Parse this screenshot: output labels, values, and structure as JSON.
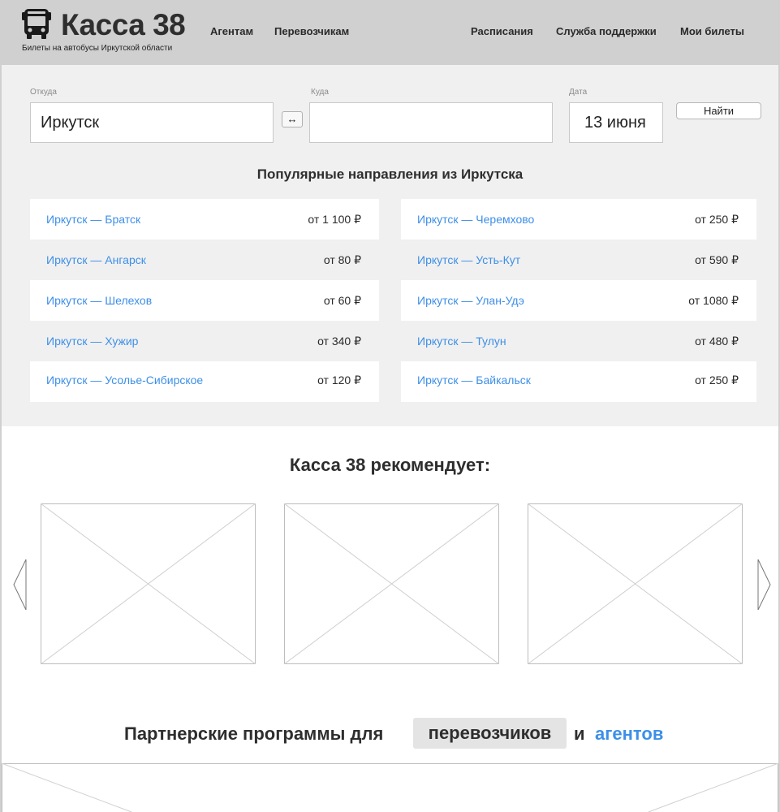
{
  "header": {
    "logo_icon": "bus-icon",
    "title": "Касса 38",
    "subtitle": "Билеты на автобусы Иркутской области",
    "nav_left": [
      "Агентам",
      "Перевозчикам"
    ],
    "nav_right": [
      "Расписания",
      "Служба поддержки",
      "Мои билеты"
    ]
  },
  "search": {
    "from_label": "Откуда",
    "from_value": "Иркутск",
    "to_label": "Куда",
    "to_value": "",
    "date_label": "Дата",
    "date_value": "13 июня",
    "swap_symbol": "↔",
    "find_label": "Найти"
  },
  "popular": {
    "title": "Популярные направления из Иркутска",
    "left": [
      {
        "route": "Иркутск — Братск",
        "price": "от 1 100 ₽"
      },
      {
        "route": "Иркутск — Ангарск",
        "price": "от 80 ₽"
      },
      {
        "route": "Иркутск — Шелехов",
        "price": "от 60 ₽"
      },
      {
        "route": "Иркутск — Хужир",
        "price": "от 340 ₽"
      },
      {
        "route": "Иркутск — Усолье-Сибирское",
        "price": "от 120 ₽"
      }
    ],
    "right": [
      {
        "route": "Иркутск — Черемхово",
        "price": "от 250 ₽"
      },
      {
        "route": "Иркутск — Усть-Кут",
        "price": "от 590 ₽"
      },
      {
        "route": "Иркутск — Улан-Удэ",
        "price": "от 1080 ₽"
      },
      {
        "route": "Иркутск — Тулун",
        "price": "от 480 ₽"
      },
      {
        "route": "Иркутск — Байкальск",
        "price": "от 250 ₽"
      }
    ]
  },
  "recommend": {
    "title": "Касса 38 рекомендует:"
  },
  "partners": {
    "text": "Партнерские программы для",
    "carriers": "перевозчиков",
    "and": "и",
    "agents": "агентов"
  },
  "colors": {
    "header_bg": "#d0d0d0",
    "section_bg": "#f0f0f0",
    "link": "#3d8fe8"
  }
}
